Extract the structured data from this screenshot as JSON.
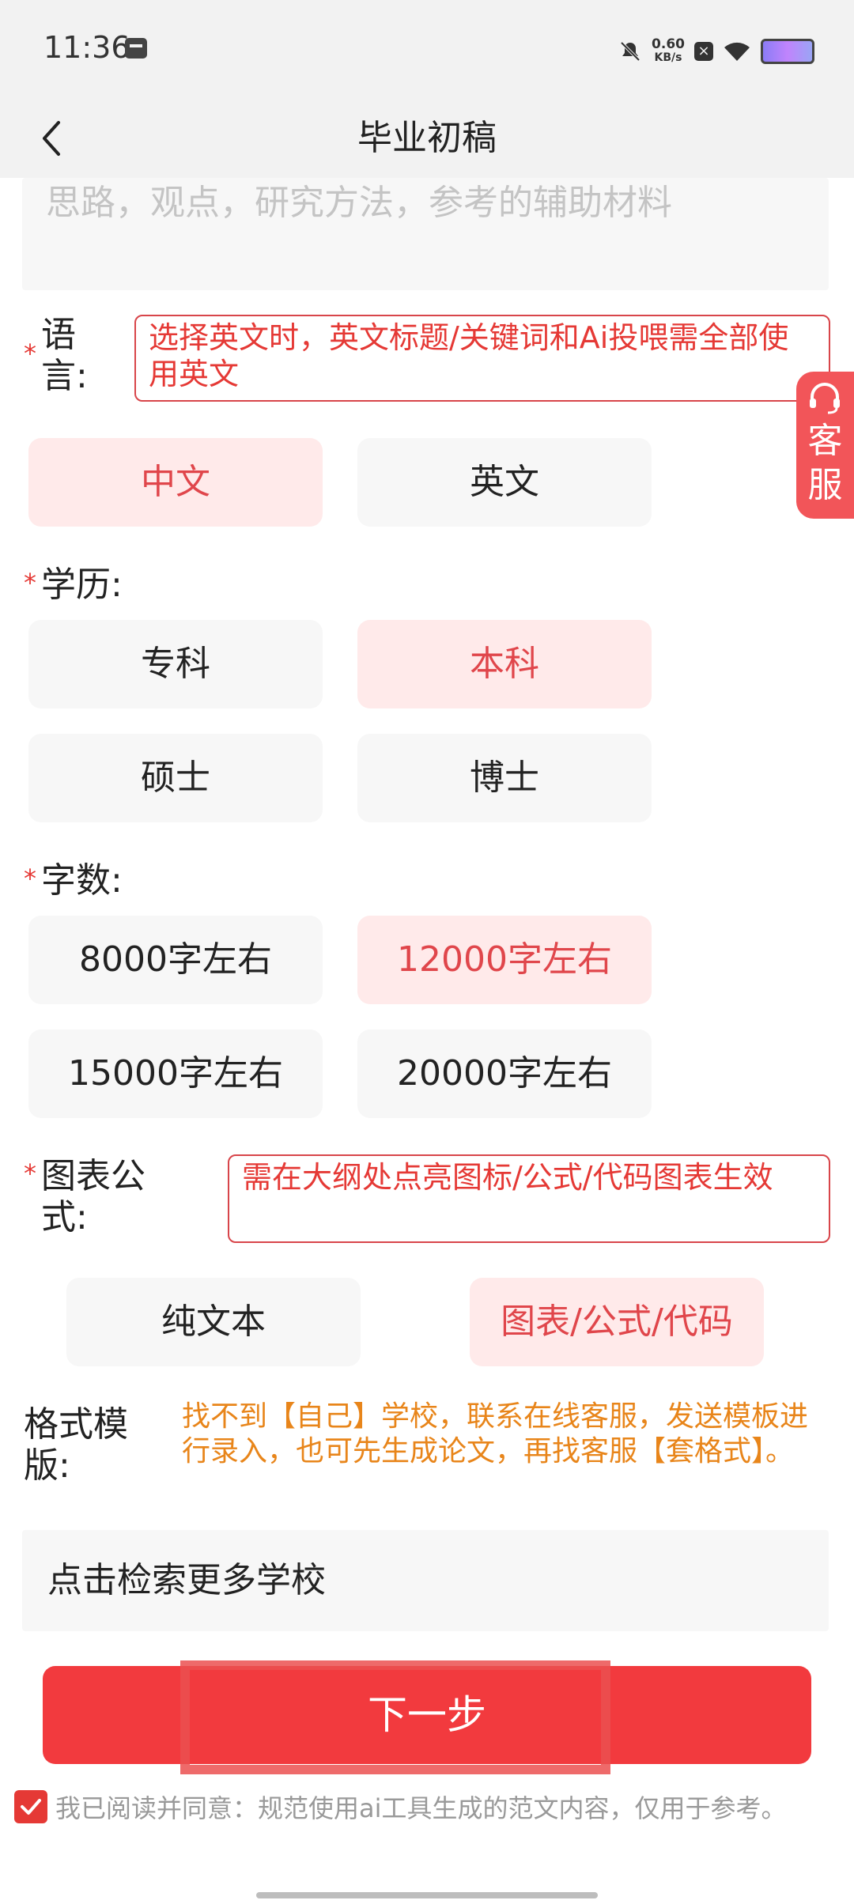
{
  "status": {
    "time": "11:36",
    "speed_value": "0.60",
    "speed_unit": "KB/s"
  },
  "header": {
    "title": "毕业初稿"
  },
  "ideas": {
    "placeholder": "思路，观点，研究方法，参考的辅助材料"
  },
  "language": {
    "label": "语言:",
    "notice": "选择英文时，英文标题/关键词和Ai投喂需全部使用英文",
    "options": [
      "中文",
      "英文"
    ],
    "selected": "中文"
  },
  "customer_service": {
    "label": "客服"
  },
  "education": {
    "label": "学历:",
    "options": [
      "专科",
      "本科",
      "硕士",
      "博士"
    ],
    "selected": "本科"
  },
  "word_count": {
    "label": "字数:",
    "options": [
      "8000字左右",
      "12000字左右",
      "15000字左右",
      "20000字左右"
    ],
    "selected": "12000字左右"
  },
  "charts": {
    "label": "图表公式:",
    "notice": "需在大纲处点亮图标/公式/代码图表生效",
    "options": [
      "纯文本",
      "图表/公式/代码"
    ],
    "selected": "图表/公式/代码"
  },
  "template": {
    "label": "格式模版:",
    "note": "找不到【自己】学校，联系在线客服，发送模板进行录入，也可先生成论文，再找客服【套格式】。",
    "search_text": "点击检索更多学校"
  },
  "actions": {
    "next_label": "下一步"
  },
  "agreement": {
    "text": "我已阅读并同意：规范使用ai工具生成的范文内容，仅用于参考。",
    "checked": true
  },
  "colors": {
    "accent": "#f23a3e",
    "selected_bg": "#ffeaea",
    "notice_orange": "#e8851a"
  }
}
